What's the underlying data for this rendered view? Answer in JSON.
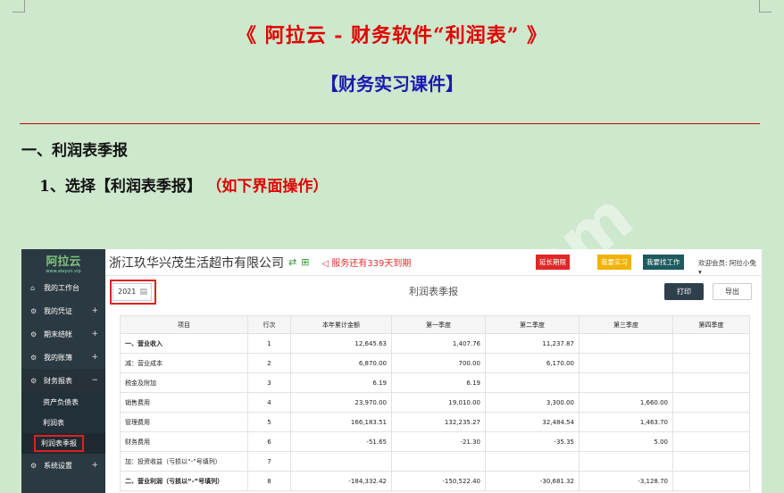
{
  "doc": {
    "title": "《 阿拉云 - 财务软件“利润表” 》",
    "subtitle": "【财务实习课件】",
    "heading1": "一、利润表季报",
    "heading2": "1、选择【利润表季报】",
    "heading2_note": "（如下界面操作）",
    "watermark": "om"
  },
  "app": {
    "logo": "阿拉云",
    "logo_sub": "www.alayun.vip",
    "company": "浙江玖华兴茂生活超市有限公司",
    "expire_notice": "◁ 服务还有339天到期",
    "btn_extend": "延长期限",
    "btn_intern": "我要实习",
    "btn_job": "我要找工作",
    "welcome": "欢迎会员: 阿拉小兔 ▾",
    "year": "2021",
    "page_title": "利润表季报",
    "btn_print": "打印",
    "btn_export": "导出"
  },
  "sidebar": [
    {
      "label": "我的工作台",
      "icon": "home-icon",
      "sign": ""
    },
    {
      "label": "我的凭证",
      "icon": "gear-icon",
      "sign": "+"
    },
    {
      "label": "期末结帐",
      "icon": "gear-icon",
      "sign": "+"
    },
    {
      "label": "我的账簿",
      "icon": "gear-icon",
      "sign": "+"
    },
    {
      "label": "财务报表",
      "icon": "gear-icon",
      "sign": "−"
    }
  ],
  "sidebar_sub": [
    "资产负债表",
    "利润表",
    "利润表季报"
  ],
  "sidebar_last": {
    "label": "系统设置",
    "icon": "gear-icon",
    "sign": "+"
  },
  "table": {
    "headers": [
      "项目",
      "行次",
      "本年累计金额",
      "第一季度",
      "第二季度",
      "第三季度",
      "第四季度"
    ],
    "rows": [
      [
        "一、营业收入",
        "1",
        "12,645.63",
        "1,407.76",
        "11,237.87",
        "",
        ""
      ],
      [
        "减：营业成本",
        "2",
        "6,870.00",
        "700.00",
        "6,170.00",
        "",
        ""
      ],
      [
        "税金及附加",
        "3",
        "6.19",
        "6.19",
        "",
        "",
        ""
      ],
      [
        "销售费用",
        "4",
        "23,970.00",
        "19,010.00",
        "3,300.00",
        "1,660.00",
        ""
      ],
      [
        "管理费用",
        "5",
        "166,183.51",
        "132,235.27",
        "32,484.54",
        "1,463.70",
        ""
      ],
      [
        "财务费用",
        "6",
        "-51.65",
        "-21.30",
        "-35.35",
        "5.00",
        ""
      ],
      [
        "加：投资收益（亏损以“-”号填列）",
        "7",
        "",
        "",
        "",
        "",
        ""
      ],
      [
        "二、营业利润（亏损以“-”号填列）",
        "8",
        "-184,332.42",
        "-150,522.40",
        "-30,681.32",
        "-3,128.70",
        ""
      ]
    ]
  }
}
